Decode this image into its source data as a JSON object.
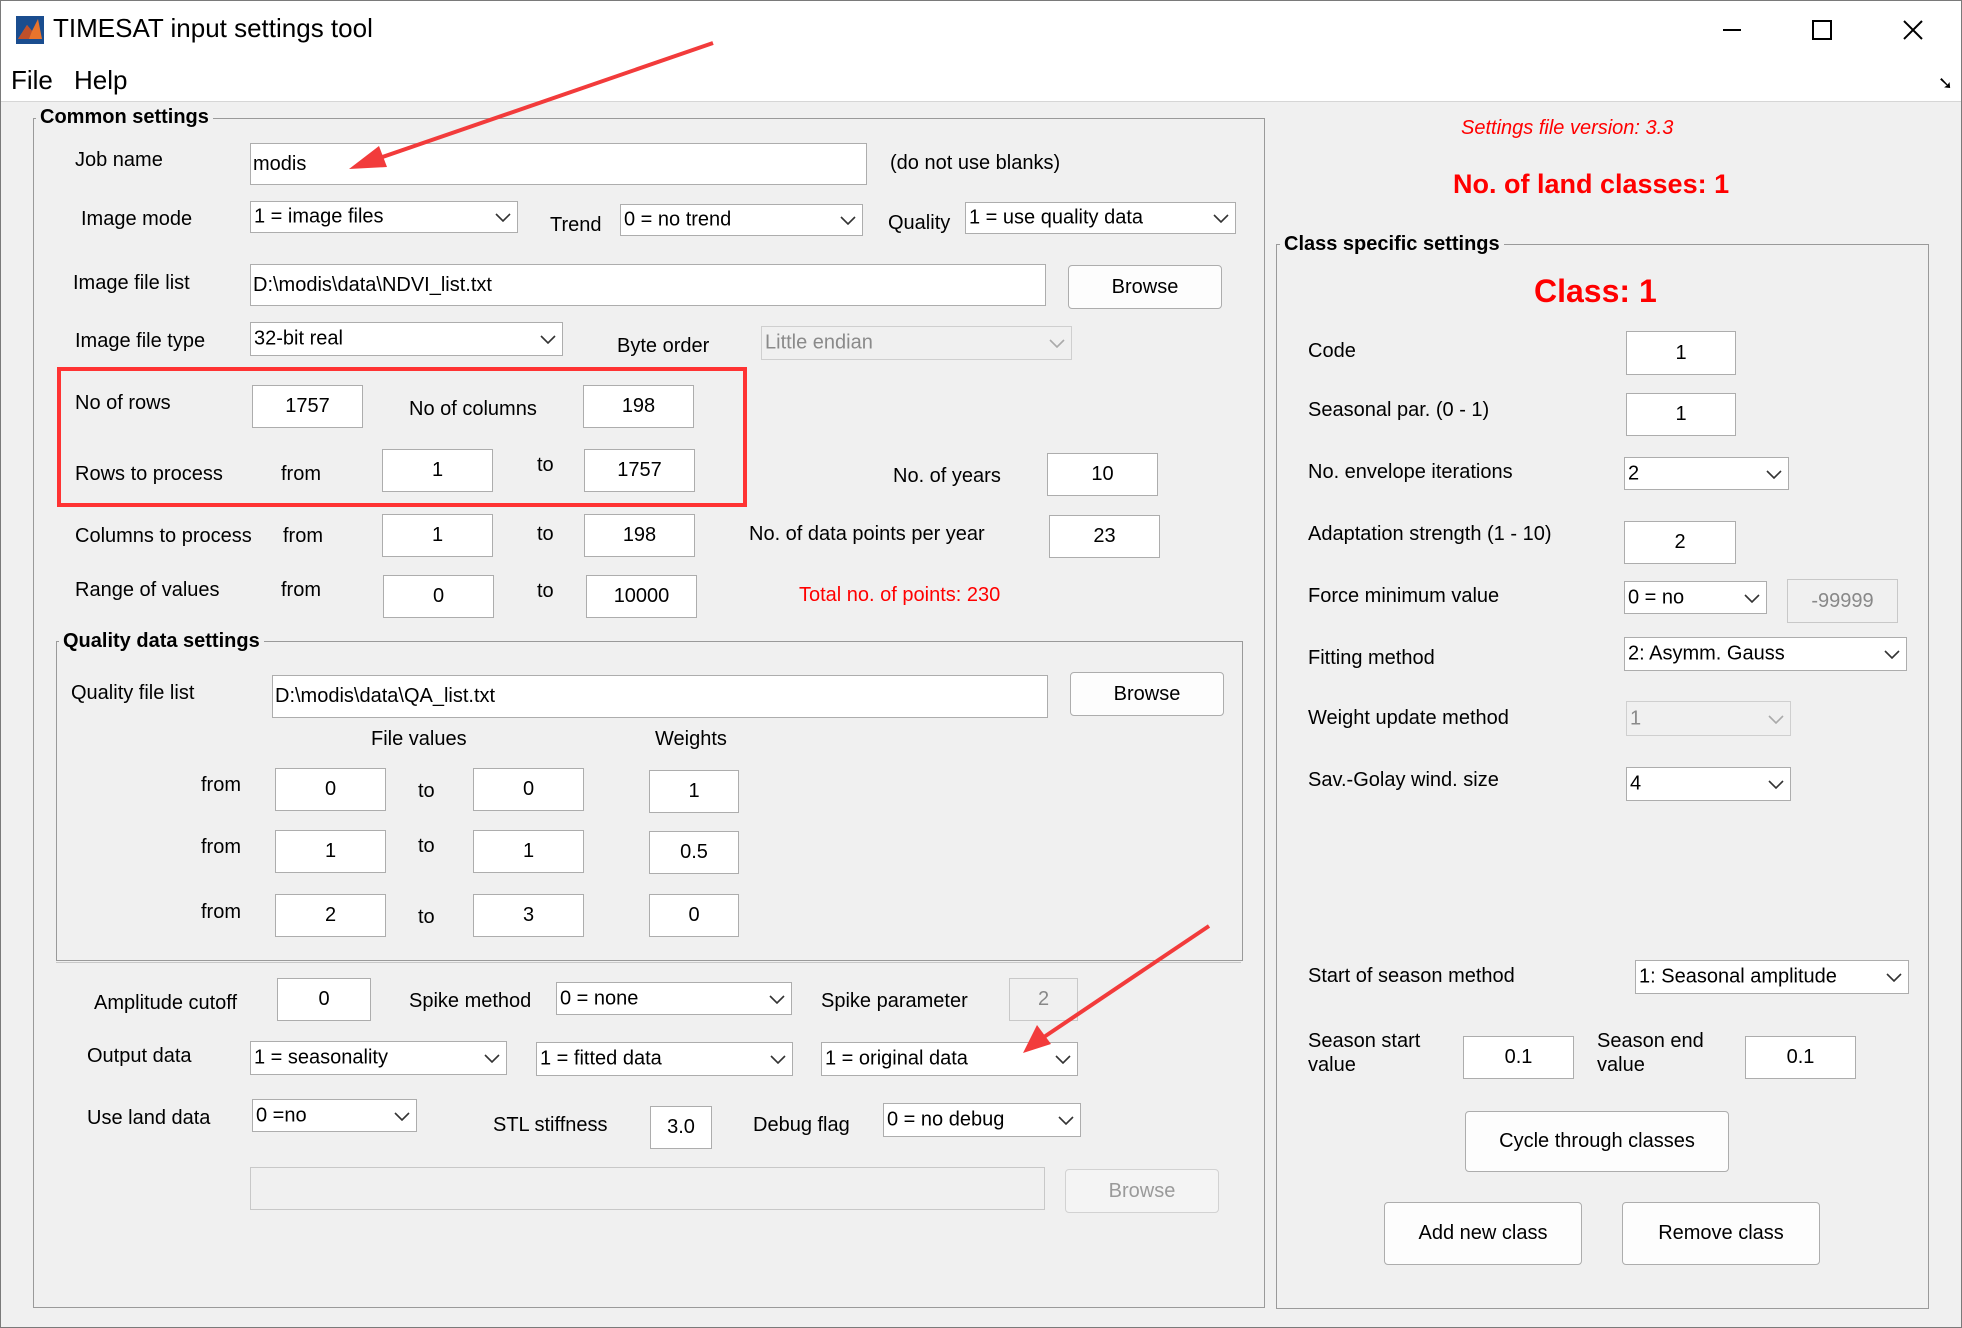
{
  "window": {
    "title": "TIMESAT input settings tool"
  },
  "menu": {
    "items": [
      "File",
      "Help"
    ]
  },
  "common": {
    "title": "Common settings",
    "job_name_label": "Job name",
    "job_name_value": "modis",
    "job_name_hint": "(do not use blanks)",
    "image_mode_label": "Image mode",
    "image_mode_value": "1 = image files",
    "trend_label": "Trend",
    "trend_value": "0 = no trend",
    "quality_label": "Quality",
    "quality_value": "1 = use quality data",
    "image_file_list_label": "Image file list",
    "image_file_list_value": "D:\\modis\\data\\NDVI_list.txt",
    "browse_label": "Browse",
    "image_file_type_label": "Image file type",
    "image_file_type_value": "32-bit real",
    "byte_order_label": "Byte order",
    "byte_order_value": "Little endian",
    "rows_label": "No of rows",
    "rows_value": "1757",
    "cols_label": "No of columns",
    "cols_value": "198",
    "rows_process_label": "Rows to process",
    "from_label": "from",
    "to_label": "to",
    "rows_from": "1",
    "rows_to": "1757",
    "years_label": "No. of years",
    "years_value": "10",
    "cols_process_label": "Columns to process",
    "cols_from": "1",
    "cols_to": "198",
    "points_label": "No. of data points per year",
    "points_value": "23",
    "range_label": "Range of values",
    "range_from": "0",
    "range_to": "10000",
    "total_points": "Total no. of points: 230"
  },
  "quality": {
    "title": "Quality data settings",
    "file_list_label": "Quality file list",
    "file_list_value": "D:\\modis\\data\\QA_list.txt",
    "browse_label": "Browse",
    "file_values_header": "File values",
    "weights_header": "Weights",
    "rows": [
      {
        "from_label": "from",
        "from": "0",
        "to_label": "to",
        "to": "0",
        "weight": "1"
      },
      {
        "from_label": "from",
        "from": "1",
        "to_label": "to",
        "to": "1",
        "weight": "0.5"
      },
      {
        "from_label": "from",
        "from": "2",
        "to_label": "to",
        "to": "3",
        "weight": "0"
      }
    ]
  },
  "bottom": {
    "amp_label": "Amplitude cutoff",
    "amp_value": "0",
    "spike_method_label": "Spike method",
    "spike_method_value": "0 = none",
    "spike_param_label": "Spike parameter",
    "spike_param_value": "2",
    "output_label": "Output data",
    "output1": "1 = seasonality",
    "output2": "1 = fitted data",
    "output3": "1 = original data",
    "land_label": "Use land data",
    "land_value": "0 =no",
    "stl_label": "STL stiffness",
    "stl_value": "3.0",
    "debug_label": "Debug flag",
    "debug_value": "0 = no debug",
    "browse_label": "Browse"
  },
  "right": {
    "version": "Settings file version: 3.3",
    "land_classes": "No. of land classes: 1",
    "class_title": "Class specific settings",
    "class_heading": "Class: 1",
    "code_label": "Code",
    "code_value": "1",
    "seasonal_label": "Seasonal par. (0 - 1)",
    "seasonal_value": "1",
    "envelope_label": "No. envelope iterations",
    "envelope_value": "2",
    "adapt_label": "Adaptation strength (1 - 10)",
    "adapt_value": "2",
    "force_label": "Force minimum value",
    "force_value": "0 = no",
    "force_min": "-99999",
    "fitting_label": "Fitting method",
    "fitting_value": "2: Asymm. Gauss",
    "weight_label": "Weight update method",
    "weight_value": "1",
    "sg_label": "Sav.-Golay wind. size",
    "sg_value": "4",
    "sos_label": "Start of season method",
    "sos_value": "1: Seasonal amplitude",
    "season_start_label_1": "Season start",
    "season_start_label_2": "value",
    "season_start_value": "0.1",
    "season_end_label_1": "Season end",
    "season_end_label_2": "value",
    "season_end_value": "0.1",
    "cycle_label": "Cycle through classes",
    "add_label": "Add new class",
    "remove_label": "Remove class"
  }
}
